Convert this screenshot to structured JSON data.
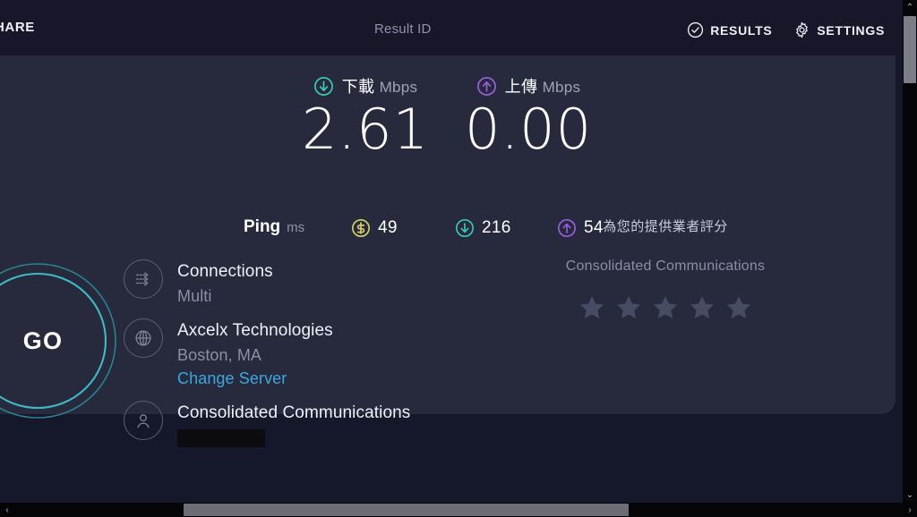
{
  "topbar": {
    "share_label": "HARE",
    "result_id_label": "Result ID",
    "results_label": "RESULTS",
    "settings_label": "SETTINGS",
    "results_icon": "check-circle-icon",
    "settings_icon": "gear-icon"
  },
  "speeds": {
    "download": {
      "label": "下載",
      "units": "Mbps",
      "value": "2.61",
      "icon": "download-arrow-icon",
      "color": "#3ec6b4"
    },
    "upload": {
      "label": "上傳",
      "units": "Mbps",
      "value": "0.00",
      "icon": "upload-arrow-icon",
      "color": "#9a5ce0"
    }
  },
  "ping": {
    "label": "Ping",
    "units": "ms",
    "idle": {
      "value": "49",
      "icon": "jitter-icon",
      "color": "#d6d066"
    },
    "download": {
      "value": "216",
      "icon": "download-arrow-icon",
      "color": "#3ec6b4"
    },
    "upload": {
      "value": "54",
      "icon": "upload-arrow-icon",
      "color": "#9a5ce0"
    }
  },
  "go_button": {
    "label": "GO",
    "ring_color": "#3fb9c4"
  },
  "info": {
    "connections": {
      "icon": "connections-icon",
      "title": "Connections",
      "subtitle": "Multi"
    },
    "server": {
      "icon": "globe-icon",
      "title": "Axcelx Technologies",
      "subtitle": "Boston, MA",
      "link": "Change Server"
    },
    "isp": {
      "icon": "person-icon",
      "title": "Consolidated Communications",
      "redacted": ""
    }
  },
  "rating": {
    "title": "為您的提供業者評分",
    "isp_name": "Consolidated Communications",
    "stars_total": 5,
    "stars_filled": 0,
    "star_color": "#474b63"
  },
  "scrollbars": {
    "vertical_up": "⌃",
    "vertical_down": "⌄",
    "horizontal_left": "‹",
    "horizontal_right": "›"
  }
}
